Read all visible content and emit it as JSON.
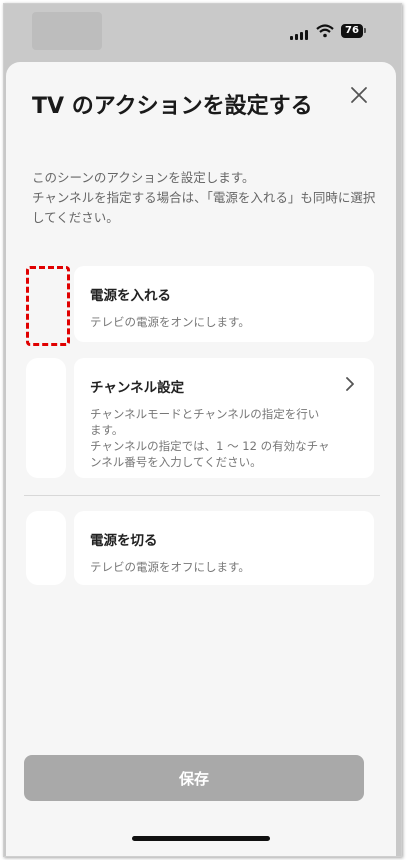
{
  "status_bar": {
    "battery": "76"
  },
  "sheet": {
    "title": "TV のアクションを設定する",
    "description": "このシーンのアクションを設定します。\nチャンネルを指定する場合は、「電源を入れる」も同時に選択してください。"
  },
  "actions": [
    {
      "title": "電源を入れる",
      "description": "テレビの電源をオンにします。"
    },
    {
      "title": "チャンネル設定",
      "description": "チャンネルモードとチャンネルの指定を行います。\nチャンネルの指定では、1 〜 12 の有効なチャンネル番号を入力してください。"
    },
    {
      "title": "電源を切る",
      "description": "テレビの電源をオフにします。"
    }
  ],
  "save_button": {
    "label": "保存"
  },
  "colors": {
    "highlight": "#e00000",
    "button_disabled": "#a9a9a9",
    "sheet_bg": "#f6f6f6"
  },
  "icons": [
    "close-icon",
    "chevron-right-icon",
    "signal-icon",
    "wifi-icon",
    "battery-icon"
  ]
}
